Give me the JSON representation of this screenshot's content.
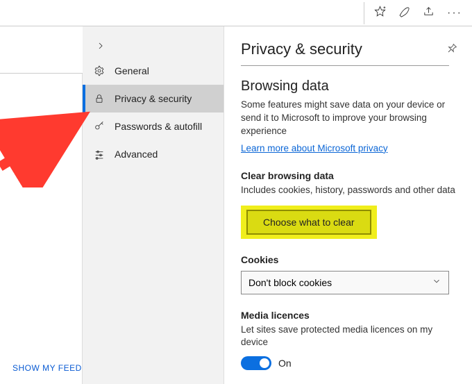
{
  "titlebar": {
    "icons": [
      "star-icon",
      "pen-icon",
      "share-icon",
      "more-icon"
    ]
  },
  "leftpane": {
    "show_feed_label": "SHOW MY FEED"
  },
  "sidebar": {
    "back_icon": "chevron-right-icon",
    "items": [
      {
        "slug": "general",
        "icon": "gear-icon",
        "label": "General",
        "selected": false
      },
      {
        "slug": "privacy-security",
        "icon": "lock-icon",
        "label": "Privacy & security",
        "selected": true
      },
      {
        "slug": "passwords-autofill",
        "icon": "key-icon",
        "label": "Passwords & autofill",
        "selected": false
      },
      {
        "slug": "advanced",
        "icon": "sliders-icon",
        "label": "Advanced",
        "selected": false
      }
    ]
  },
  "main": {
    "title": "Privacy & security",
    "browsing_data": {
      "heading": "Browsing data",
      "description": "Some features might save data on your device or send it to Microsoft to improve your browsing experience",
      "learn_more_label": "Learn more about Microsoft privacy"
    },
    "clear_data": {
      "heading": "Clear browsing data",
      "description": "Includes cookies, history, passwords and other data",
      "button_label": "Choose what to clear"
    },
    "cookies": {
      "heading": "Cookies",
      "selected_option": "Don't block cookies"
    },
    "media": {
      "heading": "Media licences",
      "description": "Let sites save protected media licences on my device",
      "toggle_state": "On"
    }
  }
}
